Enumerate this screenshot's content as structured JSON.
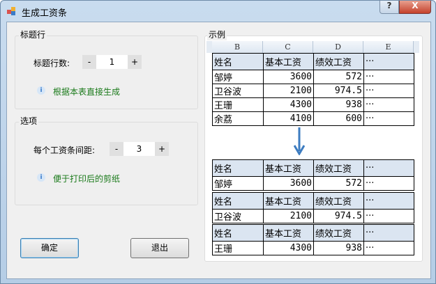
{
  "window": {
    "title": "生成工资条",
    "help_button": "?",
    "close_button": "X"
  },
  "title_group": {
    "label": "标题行",
    "rows_label": "标题行数:",
    "minus": "-",
    "value": "1",
    "plus": "+",
    "hint": "根据本表直接生成"
  },
  "options_group": {
    "label": "选项",
    "spacing_label": "每个工资条间距:",
    "minus": "-",
    "value": "3",
    "plus": "+",
    "hint": "便于打印后的剪纸"
  },
  "buttons": {
    "ok": "确定",
    "exit": "退出"
  },
  "example": {
    "label": "示例",
    "columns": [
      "B",
      "C",
      "D",
      "E"
    ],
    "header": [
      "姓名",
      "基本工资",
      "绩效工资",
      "···"
    ],
    "rows": [
      [
        "邹婷",
        "3600",
        "572",
        "···"
      ],
      [
        "卫谷波",
        "2100",
        "974.5",
        "···"
      ],
      [
        "王珊",
        "4300",
        "938",
        "···"
      ],
      [
        "余荔",
        "4100",
        "600",
        "···"
      ]
    ]
  }
}
